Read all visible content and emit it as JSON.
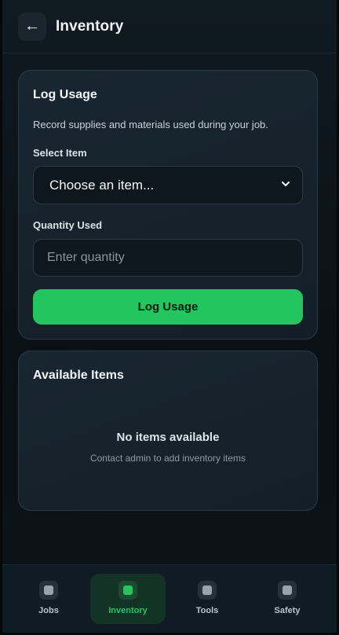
{
  "header": {
    "back_icon": "←",
    "title": "Inventory"
  },
  "log_usage": {
    "title": "Log Usage",
    "description": "Record supplies and materials used during your job.",
    "select_label": "Select Item",
    "select_value": "Choose an item...",
    "quantity_label": "Quantity Used",
    "quantity_placeholder": "Enter quantity",
    "submit_label": "Log Usage"
  },
  "available_items": {
    "title": "Available Items",
    "empty_title": "No items available",
    "empty_subtitle": "Contact admin to add inventory items"
  },
  "nav": {
    "items": [
      {
        "label": "Jobs",
        "icon": "jobs-icon",
        "active": false
      },
      {
        "label": "Inventory",
        "icon": "inventory-icon",
        "active": true
      },
      {
        "label": "Tools",
        "icon": "tools-icon",
        "active": false
      },
      {
        "label": "Safety",
        "icon": "safety-icon",
        "active": false
      }
    ]
  },
  "colors": {
    "accent": "#22c55e",
    "background": "#0b1217",
    "card": "#16232d"
  }
}
